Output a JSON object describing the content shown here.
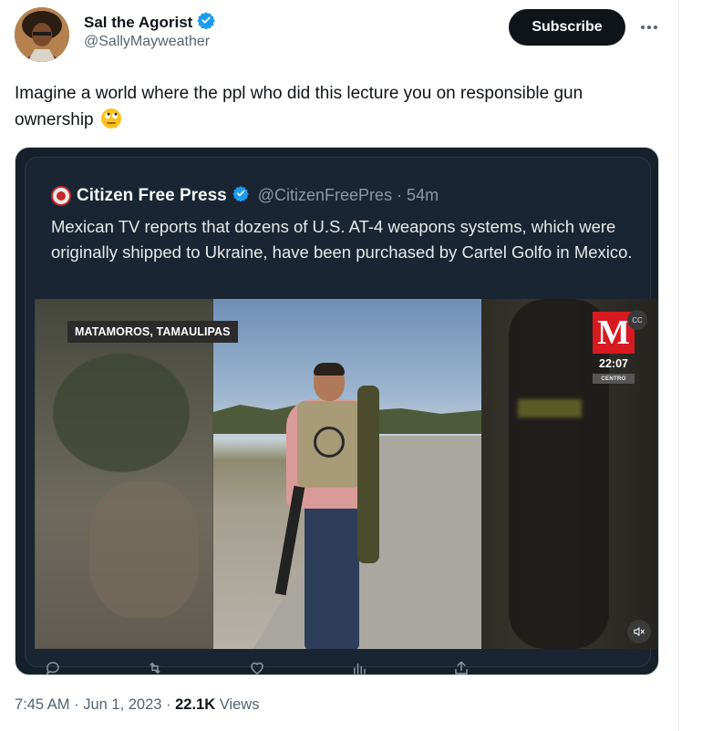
{
  "author": {
    "name": "Sal the Agorist",
    "handle": "@SallyMayweather",
    "verified_color": "#1d9bf0"
  },
  "header": {
    "subscribe_label": "Subscribe",
    "more_icon": "more-horizontal-icon"
  },
  "tweet": {
    "text": "Imagine a world where the ppl who did this lecture you on responsible gun ownership",
    "emoji": "face-with-rolling-eyes"
  },
  "quoted": {
    "name": "Citizen Free Press",
    "handle_time": "@CitizenFreePres · 54m",
    "text": "Mexican TV reports that dozens of U.S. AT-4 weapons systems, which were originally shipped to Ukraine, have been purchased by Cartel Golfo in Mexico."
  },
  "video": {
    "location": "MATAMOROS, TAMAULIPAS",
    "channel_logo": "M",
    "clock": "22:07",
    "region": "CENTRO"
  },
  "actions": [
    "reply-icon",
    "retweet-icon",
    "like-icon",
    "views-icon",
    "share-icon"
  ],
  "meta": {
    "time_date": "7:45 AM · Jun 1, 2023 · ",
    "views_count": "22.1K",
    "views_label": " Views"
  },
  "colors": {
    "brand_red": "#d71920",
    "dark_bg": "#15202b",
    "text_secondary": "#536471"
  }
}
